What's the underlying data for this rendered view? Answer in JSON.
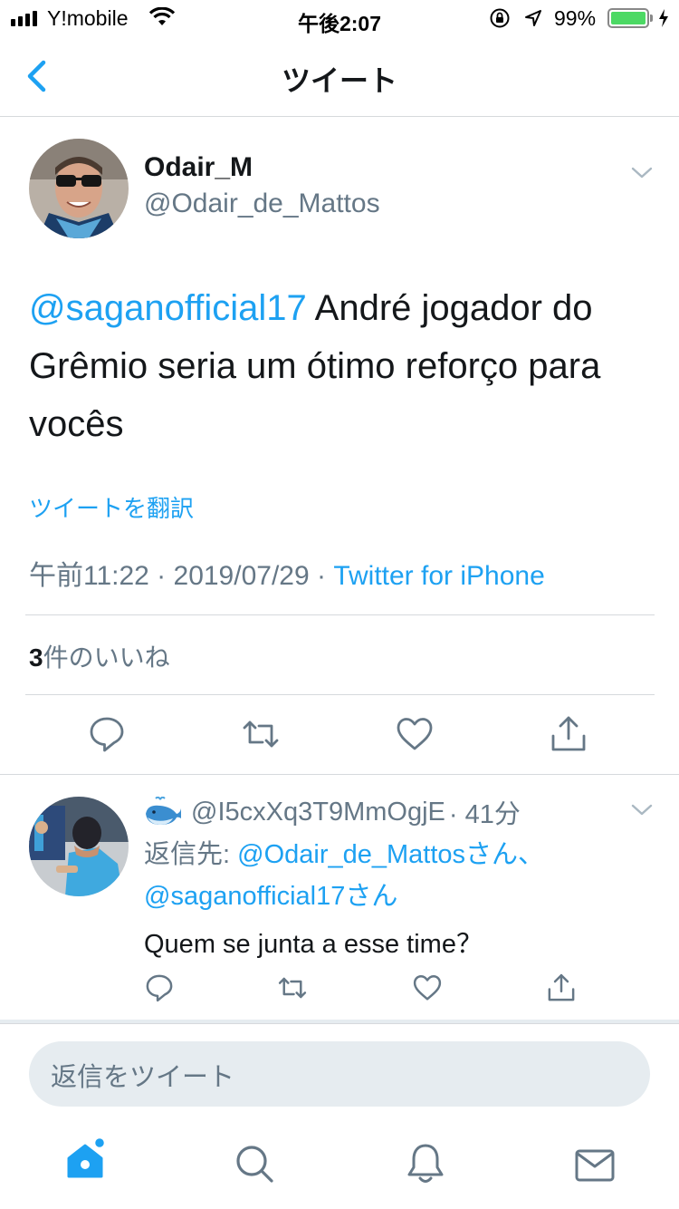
{
  "status_bar": {
    "carrier": "Y!mobile",
    "time": "午後2:07",
    "battery_pct": "99%",
    "battery_level": 0.99,
    "icons": [
      "signal-icon",
      "wifi-icon",
      "rotation-lock-icon",
      "location-icon",
      "battery-icon",
      "charging-icon"
    ]
  },
  "nav": {
    "title": "ツイート",
    "back_icon": "chevron-left-icon"
  },
  "tweet": {
    "display_name": "Odair_M",
    "handle": "@Odair_de_Mattos",
    "mention": "@saganofficial17",
    "text": " André jogador do Grêmio seria um ótimo reforço para vocês",
    "translate_label": "ツイートを翻訳",
    "timestamp": "午前11:22 · 2019/07/29 · ",
    "source": "Twitter for iPhone",
    "like_count": "3",
    "like_suffix": "件のいいね"
  },
  "reply": {
    "emoji_icon": "whale-icon",
    "handle": "@I5cxXq3T9MmOgjE",
    "age": "· 41分",
    "reply_prefix": "返信先: ",
    "reply_to_1": "@Odair_de_Mattosさん、",
    "reply_to_2": "@saganofficial17さん",
    "text": "Quem se junta a esse time？"
  },
  "compose": {
    "placeholder": "返信をツイート"
  },
  "tab_bar": {
    "items": [
      "home-icon",
      "search-icon",
      "notifications-icon",
      "messages-icon"
    ]
  },
  "colors": {
    "accent": "#1da1f2",
    "secondary_text": "#657786",
    "primary_text": "#14171a",
    "divider": "#e1e8ed"
  }
}
